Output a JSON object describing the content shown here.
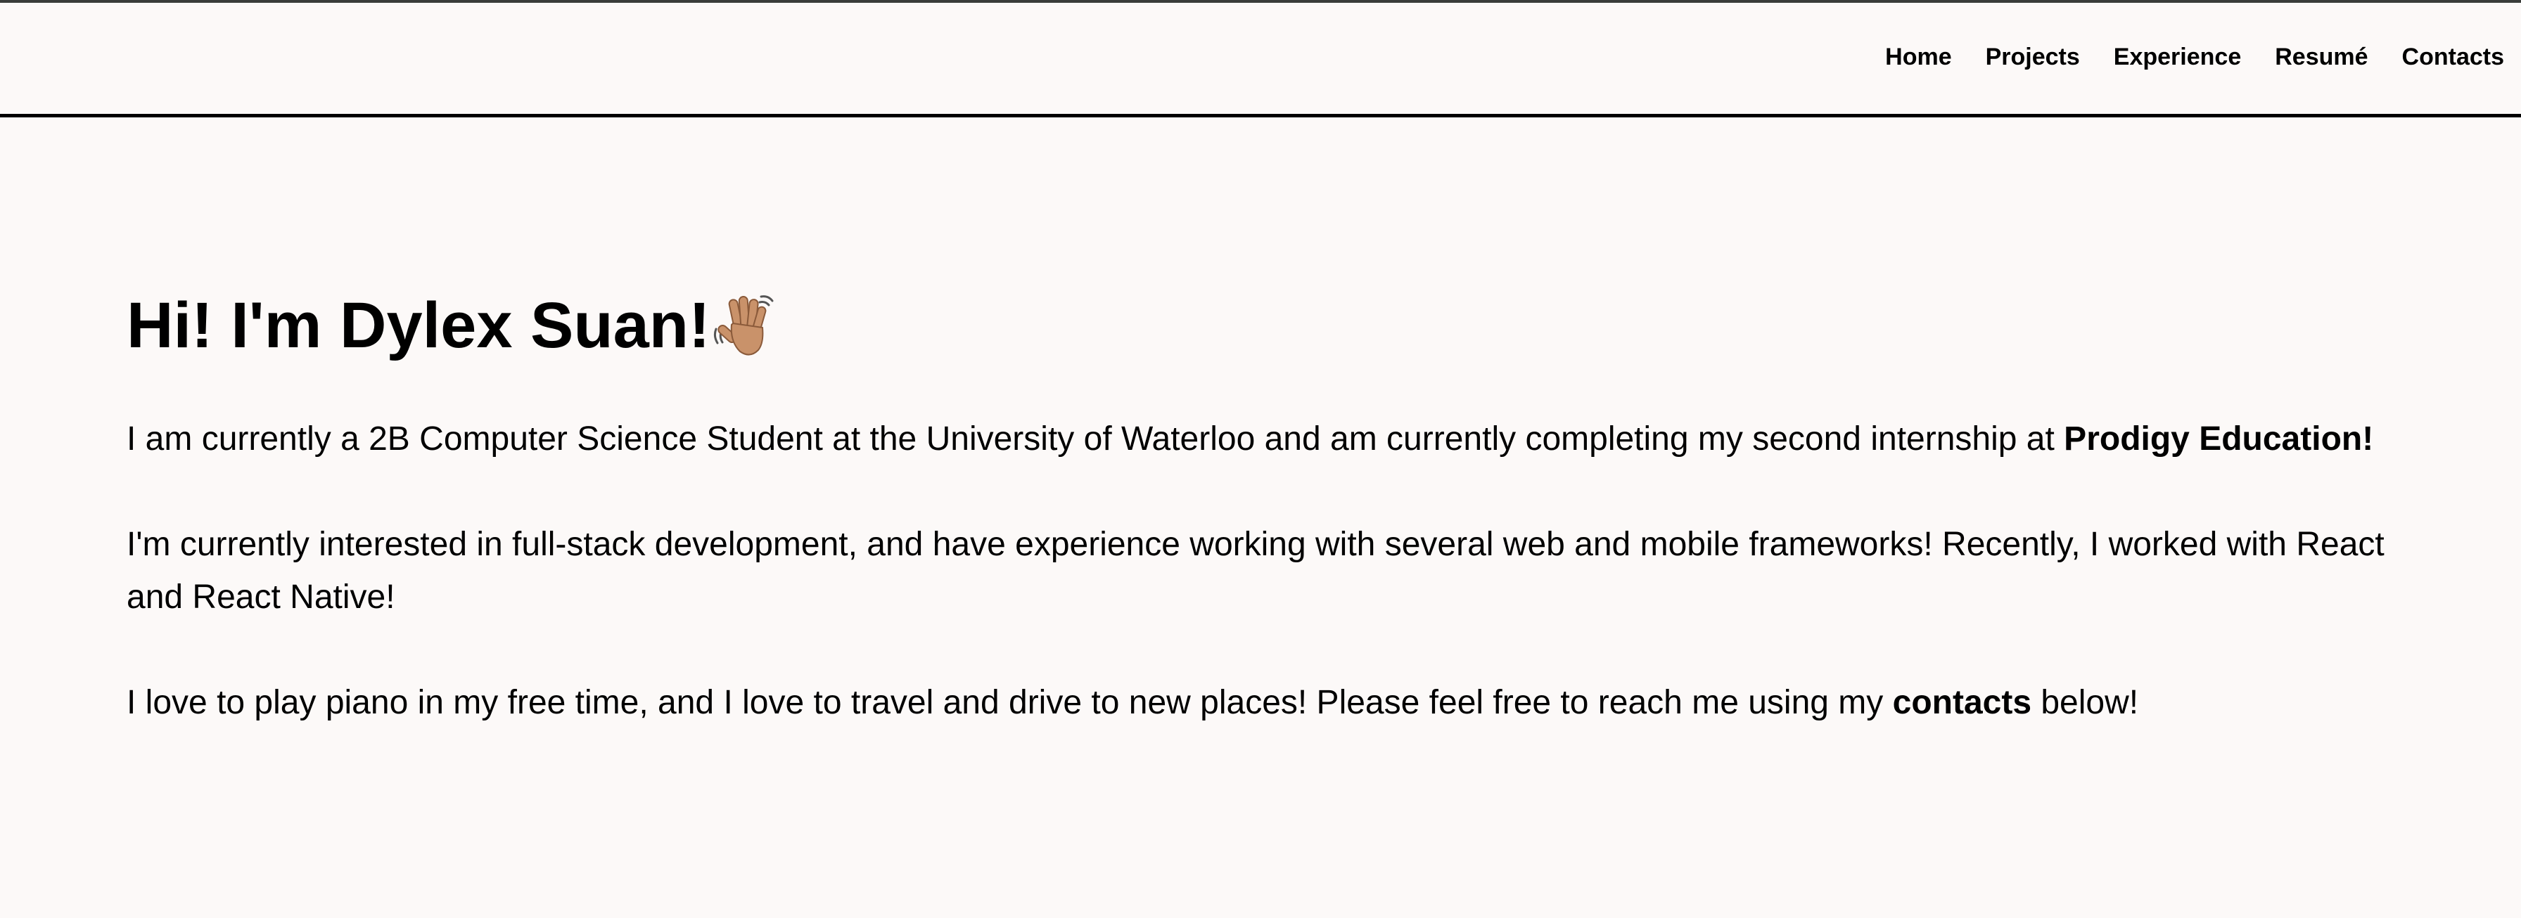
{
  "nav": {
    "items": [
      "Home",
      "Projects",
      "Experience",
      "Resumé",
      "Contacts"
    ]
  },
  "hero": {
    "title": "Hi! I'm Dylex Suan!",
    "wave_icon": "waving-hand-icon"
  },
  "intro": {
    "p1_pre": "I am currently a 2B Computer Science Student at the University of Waterloo and am currently completing my second internship at ",
    "p1_bold": "Prodigy Education!",
    "p2": "I'm currently interested in full-stack development, and have experience working with several web and mobile frameworks! Recently, I worked with React and React Native!",
    "p3_pre": "I love to play piano in my free time, and I love to travel and drive to new places! Please feel free to reach me using my ",
    "p3_bold": "contacts",
    "p3_post": " below!"
  },
  "colors": {
    "background": "#fcf9f8",
    "text": "#000000",
    "skin_tone": "#c9926a"
  }
}
